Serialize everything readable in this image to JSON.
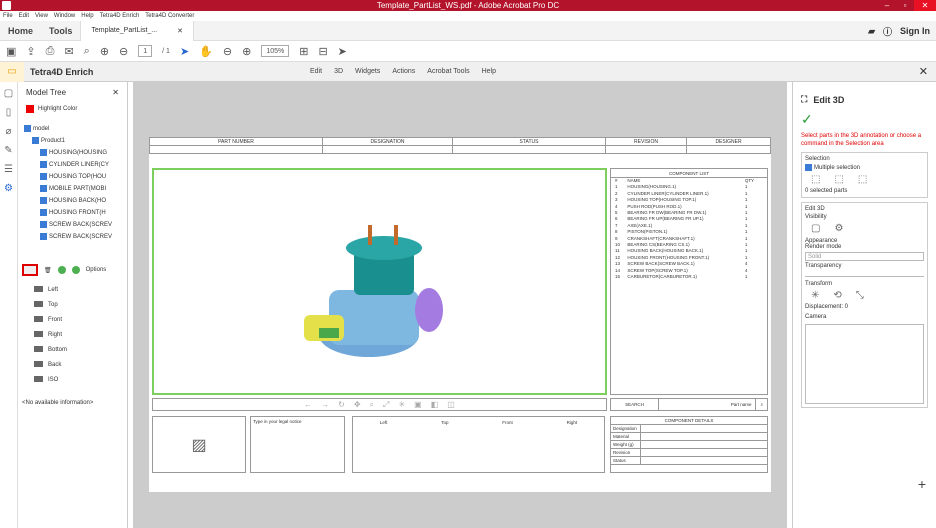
{
  "window": {
    "title": "Template_PartList_WS.pdf - Adobe Acrobat Pro DC"
  },
  "menu": [
    "File",
    "Edit",
    "View",
    "Window",
    "Help",
    "Tetra4D Enrich",
    "Tetra4D Converter"
  ],
  "tabs": {
    "home": "Home",
    "tools": "Tools",
    "doc": "Template_PartList_...",
    "signin": "Sign In"
  },
  "toolbar": {
    "page": "1",
    "pages": "/ 1",
    "zoom": "105%"
  },
  "enrich": {
    "name": "Tetra4D Enrich",
    "items": [
      "Edit",
      "3D",
      "Widgets",
      "Actions",
      "Acrobat Tools",
      "Help"
    ]
  },
  "modeltree": {
    "title": "Model Tree",
    "highlight": "Highlight Color",
    "items": [
      "model",
      "Product1",
      "HOUSING(HOUSING",
      "CYLINDER LINER(CY",
      "HOUSING TOP(HOU",
      "MOBILE PART(MOBI",
      "HOUSING BACK(HO",
      "HOUSING FRONT(H",
      "SCREW BACK(SCREV",
      "SCREW BACK(SCREV"
    ],
    "options": "Options",
    "views": [
      "Left",
      "Top",
      "Front",
      "Right",
      "Bottom",
      "Back",
      "ISO"
    ],
    "noinfo": "<No available information>"
  },
  "doc": {
    "headers": [
      "PART NUMBER",
      "DESIGNATION",
      "STATUS",
      "REVISION",
      "DESIGNER"
    ],
    "listtitle": "COMPONENT LIST",
    "listcols": [
      "#",
      "NAME",
      "QTY"
    ],
    "components": [
      [
        "1",
        "HOUSING(HOUSING.1)",
        "1"
      ],
      [
        "2",
        "CYLINDER LINER(CYLINDER LINER.1)",
        "1"
      ],
      [
        "3",
        "HOUSING TOP(HOUSING TOP.1)",
        "1"
      ],
      [
        "4",
        "PUSH ROD(PUSH ROD.1)",
        "1"
      ],
      [
        "5",
        "BEARING FR DW(BEARING FR DW.1)",
        "1"
      ],
      [
        "6",
        "BEARING FR UP(BEARING FR UP.1)",
        "1"
      ],
      [
        "7",
        "AXE(AXE.1)",
        "1"
      ],
      [
        "8",
        "PISTON(PISTON.1)",
        "1"
      ],
      [
        "9",
        "CRANKSHAFT(CRANKSHAFT.1)",
        "1"
      ],
      [
        "10",
        "BEARING CS(BEARING CS.1)",
        "1"
      ],
      [
        "11",
        "HOUSING BACK(HOUSING BACK.1)",
        "1"
      ],
      [
        "12",
        "HOUSING FRONT(HOUSING FRONT.1)",
        "1"
      ],
      [
        "13",
        "SCREW BACK(SCREW BACK.1)",
        "4"
      ],
      [
        "14",
        "SCREW TOP(SCREW TOP.1)",
        "4"
      ],
      [
        "15",
        "CARBURETOR(CARBURETOR.1)",
        "1"
      ]
    ],
    "search": "SEARCH",
    "partname": "Part name",
    "legal": "Type in your legal notice",
    "thumbs": [
      "Left",
      "Top",
      "Front",
      "Right"
    ],
    "detailstitle": "COMPONENT DETAILS",
    "details": [
      "Designation",
      "Material",
      "Weight (g)",
      "Revision",
      "Status"
    ]
  },
  "edit3d": {
    "title": "Edit 3D",
    "hint": "Select parts in the 3D annotation or choose a command in the Selection area",
    "selection": "Selection",
    "multiple": "Multiple selection",
    "selected": "0 selected parts",
    "edit": "Edit 3D",
    "visibility": "Visibility",
    "appearance": "Appearance",
    "render": "Render mode",
    "solid": "Solid",
    "transparency": "Transparency",
    "transform": "Transform",
    "displacement": "Displacement: 0",
    "camera": "Camera"
  }
}
